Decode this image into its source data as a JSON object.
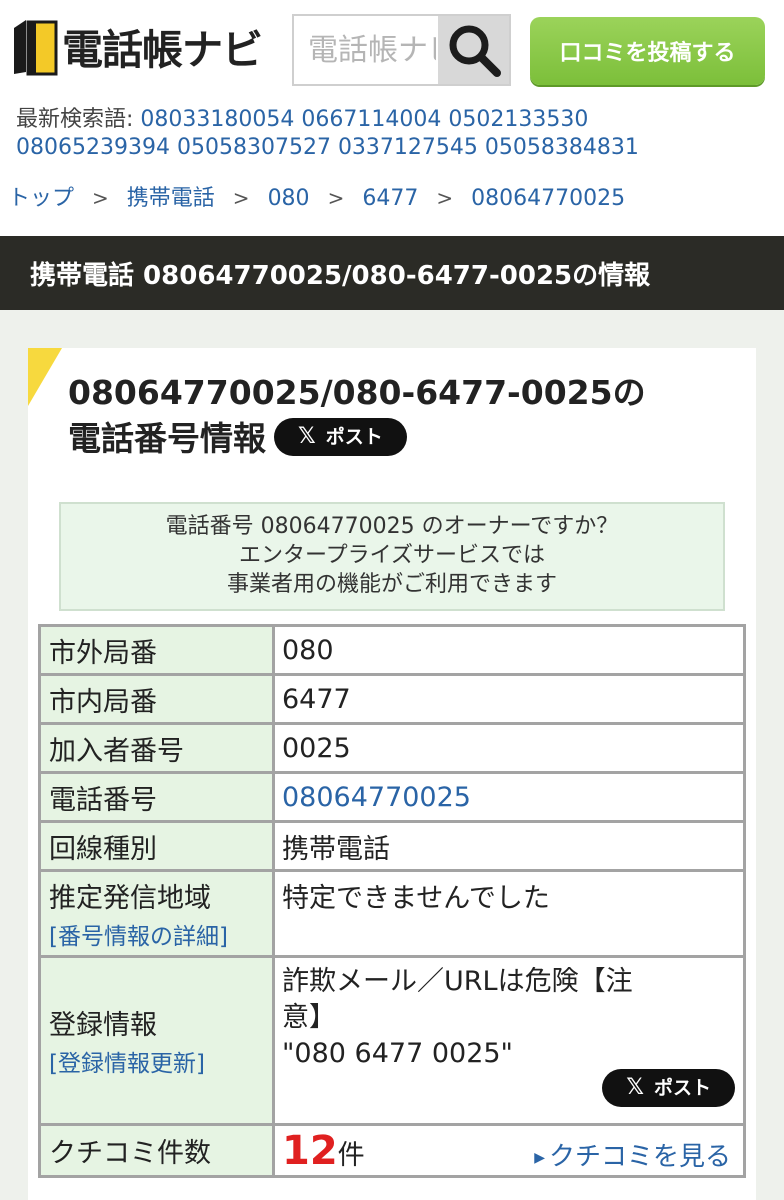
{
  "header": {
    "logo_text": "電話帳ナビ",
    "search_placeholder": "電話帳ナビ",
    "post_review_label": "口コミを投稿する"
  },
  "recent": {
    "label": "最新検索語:",
    "numbers": [
      "08033180054",
      "0667114004",
      "0502133530",
      "08065239394",
      "05058307527",
      "0337127545",
      "05058384831"
    ]
  },
  "breadcrumb": {
    "items": [
      "トップ",
      "携帯電話",
      "080",
      "6477",
      "08064770025"
    ],
    "separator": ">"
  },
  "title_bar": "携帯電話 08064770025/080-6477-0025の情報",
  "card": {
    "title_line1": "08064770025/080-6477-0025の",
    "title_line2": "電話番号情報",
    "post_label": "ポスト",
    "x_glyph": "𝕏",
    "notice": [
      "電話番号 08064770025 のオーナーですか？",
      "エンタープライズサービスでは",
      "事業者用の機能がご利用できます"
    ]
  },
  "table": {
    "rows": [
      {
        "key": "市外局番",
        "value": "080"
      },
      {
        "key": "市内局番",
        "value": "6477"
      },
      {
        "key": "加入者番号",
        "value": "0025"
      },
      {
        "key": "電話番号",
        "value": "08064770025"
      },
      {
        "key": "回線種別",
        "value": "携帯電話"
      },
      {
        "key": "推定発信地域",
        "sub": "[番号情報の詳細]",
        "value": "特定できませんでした"
      },
      {
        "key": "登録情報",
        "sub": "[登録情報更新]",
        "value_lines": [
          "詐欺メール／URLは危険【注",
          "意】",
          "\"080 6477 0025\""
        ]
      },
      {
        "key": "クチコミ件数",
        "count": "12",
        "count_unit": "件",
        "see_label": "クチコミを見る"
      }
    ]
  },
  "colors": {
    "accent_green": "#7cbf3a",
    "link_blue": "#2a64a6",
    "title_bar": "#2b2b26",
    "corner_yellow": "#f7d93e",
    "count_red": "#e02020"
  }
}
